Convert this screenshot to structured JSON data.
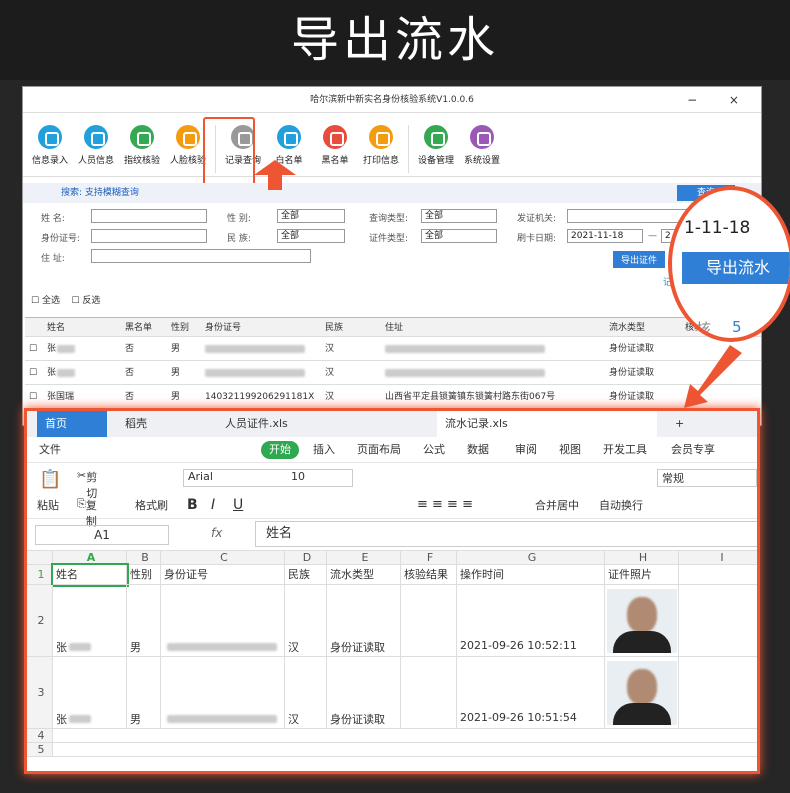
{
  "headline": "导出流水",
  "app": {
    "title": "哈尔滨新中新实名身份核验系统V1.0.0.6",
    "window_controls": "−  ×",
    "toolbar": [
      {
        "label": "信息录入",
        "color": "#21a0db"
      },
      {
        "label": "人员信息",
        "color": "#21a0db"
      },
      {
        "label": "指纹核验",
        "color": "#35a853"
      },
      {
        "label": "人脸核验",
        "color": "#f39c12"
      },
      {
        "label": "记录查询",
        "color": "#999999"
      },
      {
        "label": "白名单",
        "color": "#21a0db"
      },
      {
        "label": "黑名单",
        "color": "#e74c3c"
      },
      {
        "label": "打印信息",
        "color": "#f39c12"
      },
      {
        "label": "设备管理",
        "color": "#35a853"
      },
      {
        "label": "系统设置",
        "color": "#9b59b6"
      }
    ],
    "search_hint": "搜索: 支持模糊查询",
    "search_button": "查询",
    "form": {
      "name_label": "姓    名:",
      "id_label": "身份证号:",
      "addr_label": "住    址:",
      "gender_label": "性    别:",
      "gender_value": "全部",
      "nation_label": "民    族:",
      "nation_value": "全部",
      "query_type_label": "查询类型:",
      "query_type_value": "全部",
      "cert_type_label": "证件类型:",
      "cert_type_value": "全部",
      "issuer_label": "发证机关:",
      "swipe_date_label": "刷卡日期:",
      "date_from": "2021-11-18",
      "date_dash": "—",
      "date_to_partial": "2",
      "export_button": "导出证件",
      "record_link": "记"
    },
    "checks": {
      "all": "全选",
      "invert": "反选"
    },
    "columns": [
      "姓名",
      "黑名单",
      "性别",
      "身份证号",
      "民族",
      "住址",
      "流水类型",
      "核验"
    ],
    "rows": [
      {
        "name": "张",
        "blacklist": "否",
        "gender": "男",
        "id": "",
        "nation": "汉",
        "addr": "",
        "type": "身份证读取"
      },
      {
        "name": "张",
        "blacklist": "否",
        "gender": "男",
        "id": "",
        "nation": "汉",
        "addr": "",
        "type": "身份证读取"
      },
      {
        "name": "张国瑞",
        "blacklist": "否",
        "gender": "男",
        "id": "140321199206291181X",
        "nation": "汉",
        "addr": "山西省平定县锁簧镇东锁簧村路东街067号",
        "type": "身份证读取"
      }
    ]
  },
  "zoom": {
    "date": "1-11-18",
    "button": "导出流水",
    "count": "5",
    "partial": "核"
  },
  "excel": {
    "tabs": [
      {
        "label": "首页"
      },
      {
        "label": "稻壳"
      },
      {
        "label": "人员证件.xls"
      },
      {
        "label": "流水记录.xls"
      },
      {
        "label": "+"
      }
    ],
    "menu": [
      "文件",
      "开始",
      "插入",
      "页面布局",
      "公式",
      "数据",
      "审阅",
      "视图",
      "开发工具",
      "会员专享"
    ],
    "ribbon": {
      "paste": "粘贴",
      "cut": "剪切",
      "copy": "复制",
      "format_painter": "格式刷",
      "font": "Arial",
      "size": "10",
      "merge": "合并居中",
      "wrap": "自动换行",
      "number_format": "常规",
      "bold": "B",
      "italic": "I",
      "underline": "U"
    },
    "name_box": "A1",
    "fx": "fx",
    "formula": "姓名",
    "col_letters": [
      "A",
      "B",
      "C",
      "D",
      "E",
      "F",
      "G",
      "H",
      "I"
    ],
    "header_row": [
      "姓名",
      "性别",
      "身份证号",
      "民族",
      "流水类型",
      "核验结果",
      "操作时间",
      "证件照片"
    ],
    "rows": [
      {
        "num": "2",
        "name": "张",
        "gender": "男",
        "nation": "汉",
        "type": "身份证读取",
        "time": "2021-09-26 10:52:11"
      },
      {
        "num": "3",
        "name": "张",
        "gender": "男",
        "nation": "汉",
        "type": "身份证读取",
        "time": "2021-09-26 10:51:54"
      }
    ],
    "extra_rows": [
      "1",
      "4",
      "5"
    ]
  }
}
